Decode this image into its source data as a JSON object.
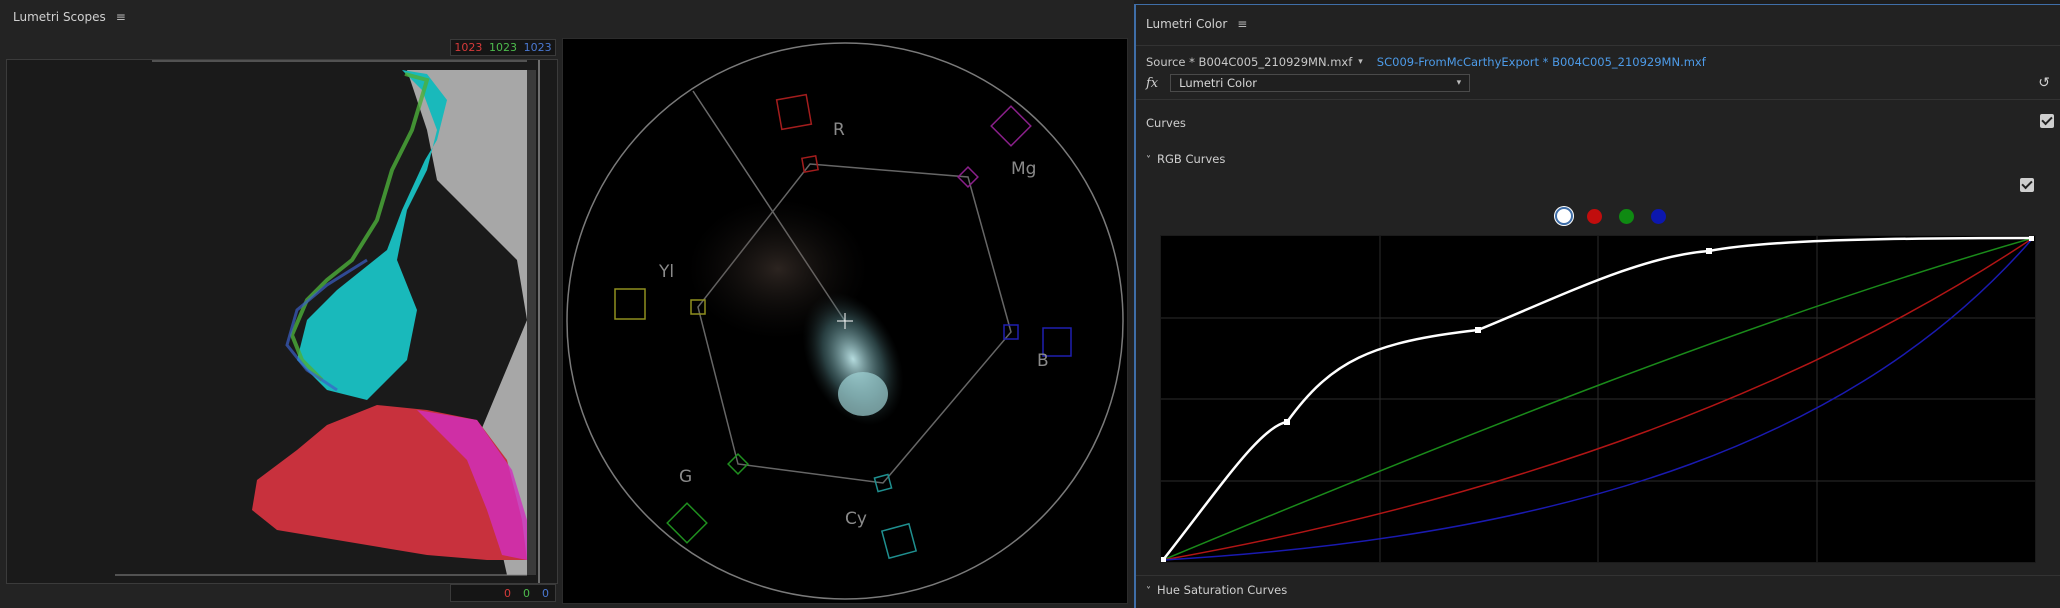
{
  "scopes": {
    "title": "Lumetri Scopes",
    "menu_icon": "hamburger-icon",
    "parade": {
      "top_values": [
        "1023",
        "1023",
        "1023"
      ],
      "bottom_values": [
        "0",
        "0",
        "0"
      ],
      "colors": {
        "red": "#d63a3a",
        "green": "#4dbb4d",
        "blue": "#4a78d2"
      }
    },
    "vectorscope": {
      "targets": [
        "R",
        "Mg",
        "B",
        "Cy",
        "G",
        "Yl"
      ]
    }
  },
  "lumetri_color": {
    "title": "Lumetri Color",
    "menu_icon": "hamburger-icon",
    "source_label": "Source * B004C005_210929MN.mxf",
    "sequence_label": "SC009-FromMcCarthyExport * B004C005_210929MN.mxf",
    "fx_label": "fx",
    "effect_select": "Lumetri Color",
    "sections": {
      "curves": "Curves",
      "rgb_curves": "RGB Curves",
      "hue_saturation": "Hue Saturation Curves"
    },
    "accent_color": "#3f6ea8",
    "channels": [
      "white",
      "red",
      "green",
      "blue"
    ]
  }
}
